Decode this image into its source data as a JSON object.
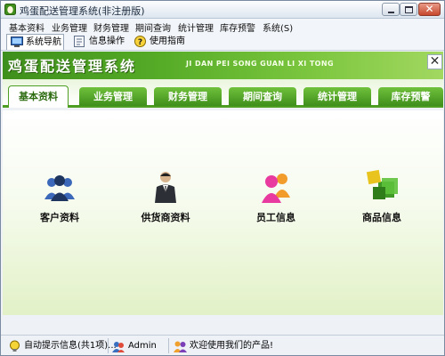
{
  "window": {
    "title": "鸡蛋配送管理系统(非注册版)",
    "controls": {
      "minimize": "minimize",
      "maximize": "maximize",
      "close": "✕"
    }
  },
  "menubar": [
    "基本资料",
    "业务管理",
    "财务管理",
    "期间查询",
    "统计管理",
    "库存预警",
    "系统(S)"
  ],
  "toolbar": {
    "items": [
      {
        "label": "系统导航",
        "icon": "monitor-icon",
        "active": true
      },
      {
        "label": "信息操作",
        "icon": "document-icon",
        "active": false
      },
      {
        "label": "使用指南",
        "icon": "help-icon",
        "active": false
      }
    ]
  },
  "banner": {
    "title": "鸡蛋配送管理系统",
    "subtitle": "JI DAN PEI SONG GUAN LI XI TONG",
    "close_label": "✕"
  },
  "tabs": [
    "基本资料",
    "业务管理",
    "财务管理",
    "期间查询",
    "统计管理",
    "库存预警"
  ],
  "active_tab": "基本资料",
  "modules": [
    {
      "label": "客户资料",
      "icon": "customers-icon"
    },
    {
      "label": "供货商资料",
      "icon": "supplier-icon"
    },
    {
      "label": "员工信息",
      "icon": "staff-icon"
    },
    {
      "label": "商品信息",
      "icon": "goods-icon"
    }
  ],
  "statusbar": {
    "auto_tip": "自动提示信息(共1项)...",
    "user": "Admin",
    "welcome": "欢迎使用我们的产品!"
  },
  "colors": {
    "banner_green": "#4aa021",
    "tab_green": "#5aae2e",
    "accent": "#2c6b0f"
  }
}
